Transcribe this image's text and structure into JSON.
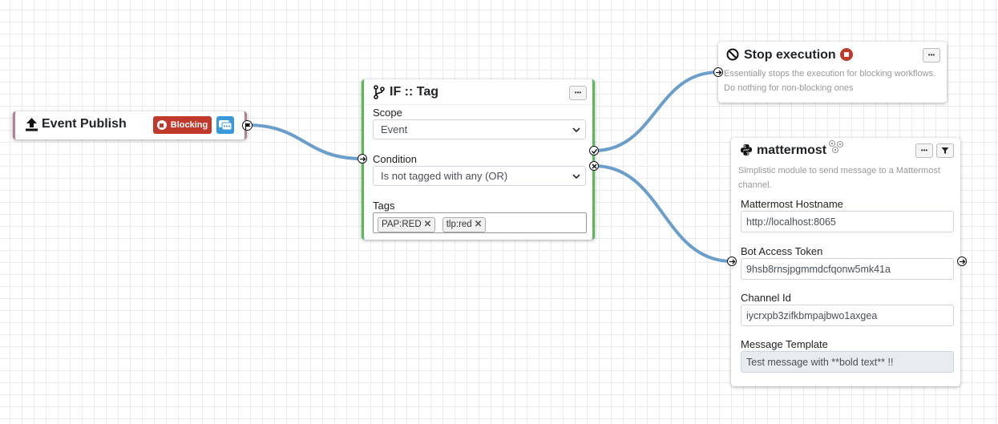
{
  "event_publish": {
    "title": "Event Publish",
    "icon": "upload-icon",
    "badge_label": "Blocking",
    "badge_color": "#c0392b"
  },
  "if_tag": {
    "title": "IF :: Tag",
    "icon": "branch-icon",
    "scope_label": "Scope",
    "scope_value": "Event",
    "condition_label": "Condition",
    "condition_value": "Is not tagged with any (OR)",
    "tags_label": "Tags",
    "tags": [
      "PAP:RED",
      "tlp:red"
    ],
    "accent_color": "#5cb85c"
  },
  "stop_execution": {
    "title": "Stop execution",
    "icon": "ban-icon",
    "description_line1": "Essentially stops the execution for blocking workflows.",
    "description_line2": "Do nothing for non-blocking ones"
  },
  "mattermost": {
    "title": "mattermost",
    "icon": "python-icon",
    "description_line1": "Simplistic module to send message to a Mattermost",
    "description_line2": "channel.",
    "hostname_label": "Mattermost Hostname",
    "hostname_value": "http://localhost:8065",
    "token_label": "Bot Access Token",
    "token_value": "9hsb8rnsjpgmmdcfqonw5mk41a",
    "channel_label": "Channel Id",
    "channel_value": "iycrxpb3zifkbmpajbwo1axgea",
    "template_label": "Message Template",
    "template_value": "Test message with **bold text** !!"
  },
  "options_button_label": "•••",
  "wire_color": "#6c9ecb"
}
